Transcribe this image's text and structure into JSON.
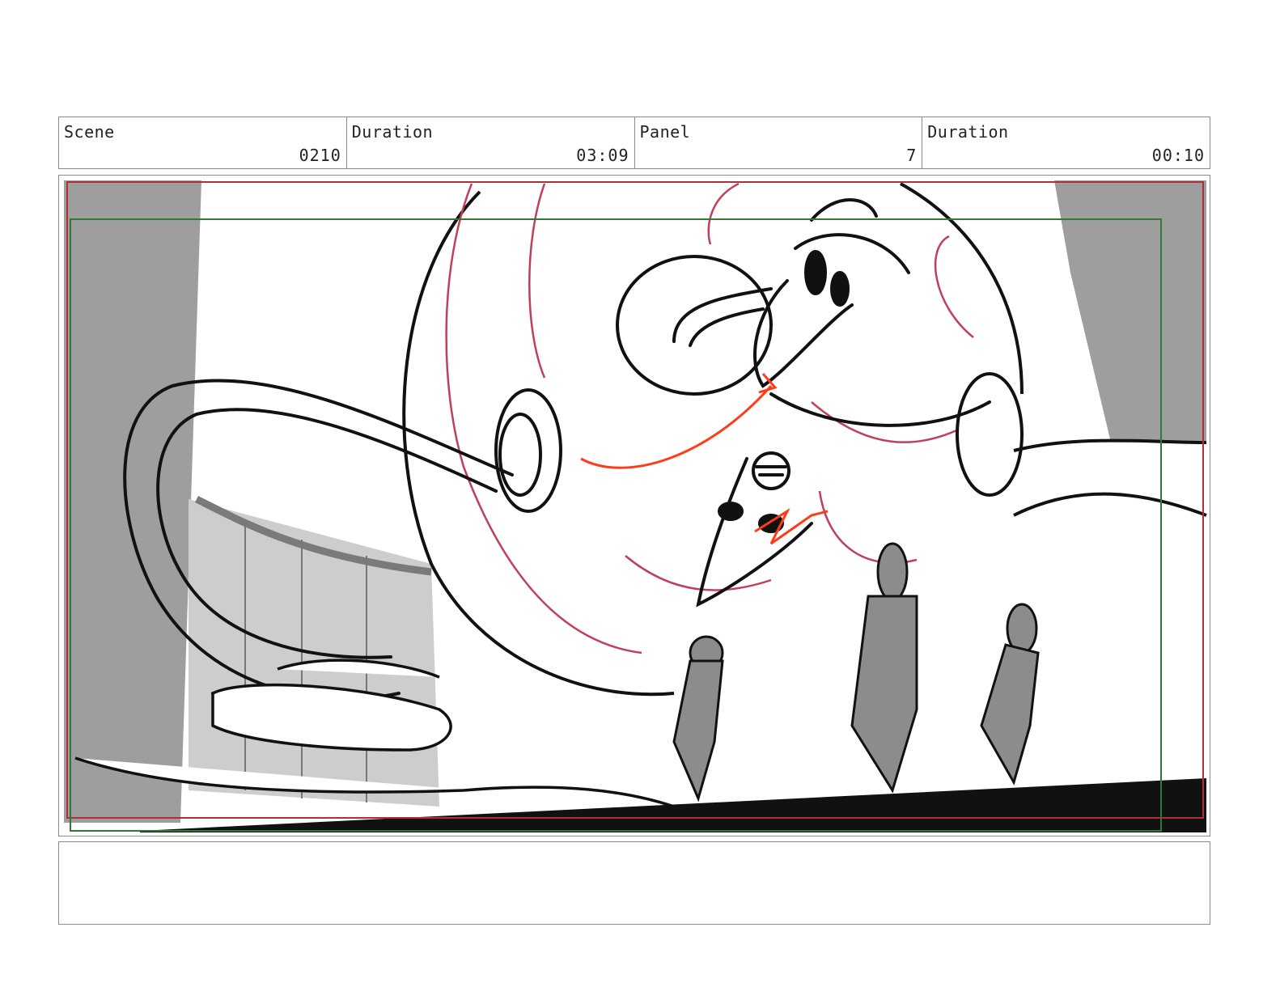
{
  "header": {
    "scene": {
      "label": "Scene",
      "value": "0210"
    },
    "scene_duration": {
      "label": "Duration",
      "value": "03:09"
    },
    "panel": {
      "label": "Panel",
      "value": "7"
    },
    "panel_duration": {
      "label": "Duration",
      "value": "00:10"
    }
  },
  "frame_guides": {
    "action_safe_color": "#b0303a",
    "title_safe_color": "#2f7a2f",
    "direction_arrow_color": "#ff3b1a"
  },
  "notes": {
    "text": ""
  }
}
